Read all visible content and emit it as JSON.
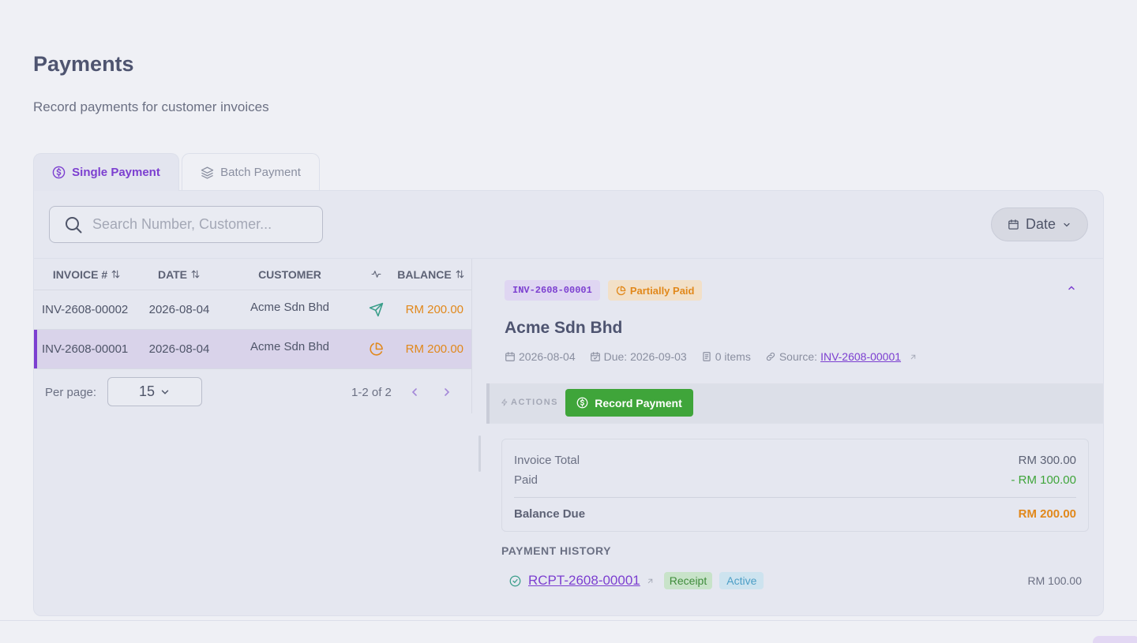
{
  "page": {
    "title": "Payments",
    "subtitle": "Record payments for customer invoices"
  },
  "tabs": [
    {
      "label": "Single Payment",
      "icon": "dollar-circle-icon",
      "active": true
    },
    {
      "label": "Batch Payment",
      "icon": "layers-icon",
      "active": false
    }
  ],
  "toolbar": {
    "search_placeholder": "Search Number, Customer...",
    "date_filter_label": "Date"
  },
  "table": {
    "columns": [
      "INVOICE #",
      "DATE",
      "CUSTOMER",
      "",
      "BALANCE"
    ],
    "rows": [
      {
        "invoice": "INV-2608-00002",
        "date": "2026-08-04",
        "customer": "Acme Sdn Bhd",
        "status_icon": "send-icon",
        "balance": "RM 200.00",
        "selected": false
      },
      {
        "invoice": "INV-2608-00001",
        "date": "2026-08-04",
        "customer": "Acme Sdn Bhd",
        "status_icon": "pie-chart-icon",
        "balance": "RM 200.00",
        "selected": true
      }
    ]
  },
  "pagination": {
    "per_page_label": "Per page:",
    "per_page_value": "15",
    "range": "1-2 of 2"
  },
  "detail": {
    "invoice_badge": "INV-2608-00001",
    "status_badge": "Partially Paid",
    "customer": "Acme Sdn Bhd",
    "date": "2026-08-04",
    "due": "Due: 2026-09-03",
    "items": "0 items",
    "source_label": "Source:",
    "source_link": "INV-2608-00001",
    "actions_label": "ACTIONS",
    "record_payment_label": "Record Payment",
    "summary": {
      "invoice_total_label": "Invoice Total",
      "invoice_total_value": "RM 300.00",
      "paid_label": "Paid",
      "paid_value": "- RM 100.00",
      "balance_label": "Balance Due",
      "balance_value": "RM 200.00"
    },
    "history_title": "PAYMENT HISTORY",
    "history": [
      {
        "number": "RCPT-2608-00001",
        "type": "Receipt",
        "status": "Active",
        "amount": "RM 100.00"
      }
    ]
  },
  "colors": {
    "accent": "#7c3fd0",
    "warning": "#e1881b",
    "success": "#3fa53a",
    "info": "#4c9ec6"
  }
}
